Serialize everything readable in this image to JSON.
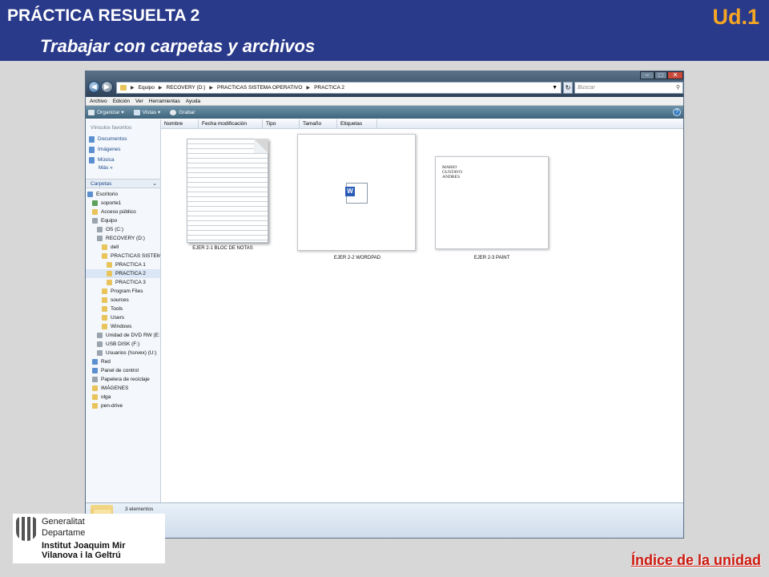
{
  "slide": {
    "title": "PRÁCTICA RESUELTA 2",
    "subtitle": "Trabajar con carpetas y archivos",
    "unit": "Ud.1",
    "index_link": "Índice de la unidad",
    "logo": {
      "line1": "Generalitat",
      "line2": "Departame",
      "line3": "Institut Joaquim Mir",
      "line4": "Vilanova i la Geltrú"
    }
  },
  "explorer": {
    "address": [
      "Equipo",
      "RECOVERY (D:)",
      "PRACTICAS SISTEMA OPERATIVO",
      "PRACTICA 2"
    ],
    "search_placeholder": "Buscar",
    "menu": [
      "Archivo",
      "Edición",
      "Ver",
      "Herramientas",
      "Ayuda"
    ],
    "toolbar": [
      "Organizar",
      "Vistas",
      "Grabar"
    ],
    "favorites_header": "Vínculos favoritos",
    "favorites": [
      "Documentos",
      "Imágenes",
      "Música"
    ],
    "more": "Más »",
    "folders_header": "Carpetas",
    "tree": [
      {
        "label": "Escritorio",
        "indent": 0,
        "icon": "blue"
      },
      {
        "label": "soporte1",
        "indent": 1,
        "icon": "green"
      },
      {
        "label": "Acceso público",
        "indent": 1,
        "icon": "folder"
      },
      {
        "label": "Equipo",
        "indent": 1,
        "icon": "gray"
      },
      {
        "label": "OS (C:)",
        "indent": 2,
        "icon": "gray"
      },
      {
        "label": "RECOVERY (D:)",
        "indent": 2,
        "icon": "gray"
      },
      {
        "label": "dell",
        "indent": 3,
        "icon": "folder"
      },
      {
        "label": "PRACTICAS SISTEMA",
        "indent": 3,
        "icon": "folder"
      },
      {
        "label": "PRACTICA 1",
        "indent": 4,
        "icon": "folder"
      },
      {
        "label": "PRACTICA 2",
        "indent": 4,
        "icon": "folder",
        "selected": true
      },
      {
        "label": "PRACTICA 3",
        "indent": 4,
        "icon": "folder"
      },
      {
        "label": "Program Files",
        "indent": 3,
        "icon": "folder"
      },
      {
        "label": "sources",
        "indent": 3,
        "icon": "folder"
      },
      {
        "label": "Tools",
        "indent": 3,
        "icon": "folder"
      },
      {
        "label": "Users",
        "indent": 3,
        "icon": "folder"
      },
      {
        "label": "Windows",
        "indent": 3,
        "icon": "folder"
      },
      {
        "label": "Unidad de DVD RW (E:",
        "indent": 2,
        "icon": "gray"
      },
      {
        "label": "USB DISK (F:)",
        "indent": 2,
        "icon": "gray"
      },
      {
        "label": "Usuarios (\\\\srvex) (U:)",
        "indent": 2,
        "icon": "gray"
      },
      {
        "label": "Red",
        "indent": 1,
        "icon": "blue"
      },
      {
        "label": "Panel de control",
        "indent": 1,
        "icon": "blue"
      },
      {
        "label": "Papelera de reciclaje",
        "indent": 1,
        "icon": "gray"
      },
      {
        "label": "IMÁGENES",
        "indent": 1,
        "icon": "folder"
      },
      {
        "label": "olga",
        "indent": 1,
        "icon": "folder"
      },
      {
        "label": "pen-drive",
        "indent": 1,
        "icon": "folder"
      }
    ],
    "columns": [
      "Nombre",
      "Fecha modificación",
      "Tipo",
      "Tamaño",
      "Etiquetas"
    ],
    "files": [
      {
        "name": "EJER 2-1 BLOC DE NOTAS"
      },
      {
        "name": "EJER 2-2 WORDPAD"
      },
      {
        "name": "EJER 2-3 PAINT",
        "thumb_text": [
          "MARIO",
          "GUSTAVO",
          "ANDRES"
        ]
      }
    ],
    "status": "3 elementos"
  }
}
